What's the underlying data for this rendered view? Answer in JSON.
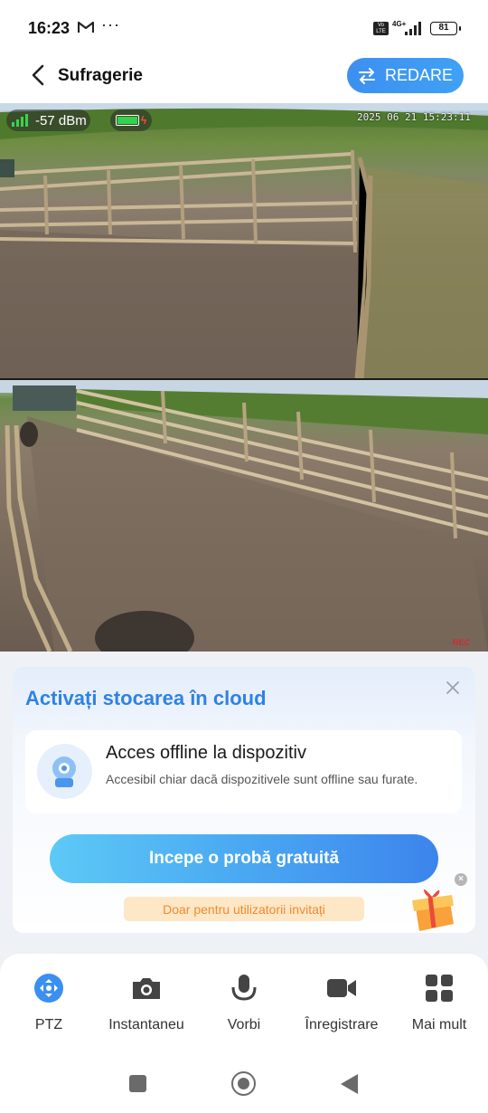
{
  "status_bar": {
    "time": "16:23",
    "icons": [
      "gmail-icon",
      "more-dots-icon",
      "volte-icon",
      "4g-icon",
      "signal-icon"
    ],
    "network": "4G+",
    "volte": "Vo LTE",
    "battery": "81"
  },
  "header": {
    "title": "Sufragerie",
    "redare_label": "REDARE"
  },
  "camera": {
    "signal_label": "-57 dBm",
    "timestamp": "2025 06 21 15:23:11",
    "watermark": "REC",
    "battery_color": "#33d14d"
  },
  "cloud": {
    "title": "Activați stocarea în cloud",
    "feature_title": "Acces offline la dispozitiv",
    "feature_desc": "Accesibil chiar dacă dispozitivele sunt offline sau furate.",
    "trial_button": "Incepe o probă gratuită",
    "invite_note": "Doar pentru utilizatorii invitați",
    "accent_color": "#2e82e5"
  },
  "toolbar": {
    "items": [
      {
        "label": "PTZ",
        "icon": "ptz-icon"
      },
      {
        "label": "Instantaneu",
        "icon": "camera-icon"
      },
      {
        "label": "Vorbi",
        "icon": "microphone-icon"
      },
      {
        "label": "Înregistrare",
        "icon": "video-record-icon"
      },
      {
        "label": "Mai mult",
        "icon": "grid-more-icon"
      }
    ]
  }
}
